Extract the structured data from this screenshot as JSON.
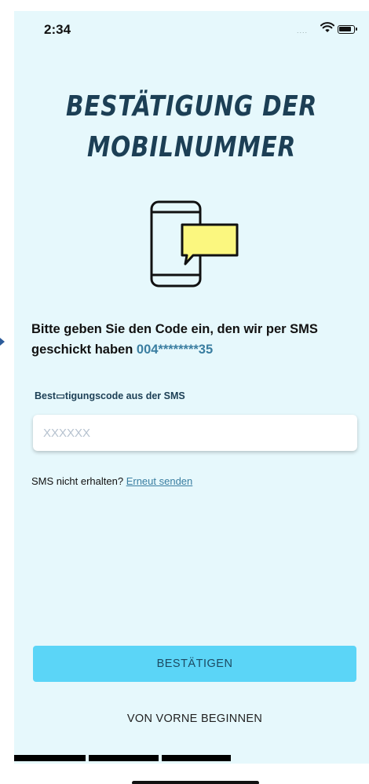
{
  "status_bar": {
    "time": "2:34",
    "signal": "....",
    "wifi_icon": "wifi-icon",
    "battery_icon": "battery-icon"
  },
  "header": {
    "title_line1": "BESTÄTIGUNG DER",
    "title_line2": "MOBILNUMMER"
  },
  "illustration": {
    "icon": "phone-sms-icon",
    "bubble_color": "#fbf77f"
  },
  "instruction": {
    "text": "Bitte geben Sie den Code ein, den wir per SMS geschickt haben",
    "masked_number": "004********35"
  },
  "code_field": {
    "label": "Best▭tigungscode aus der SMS",
    "placeholder": "XXXXXX",
    "value": ""
  },
  "resend": {
    "prompt": "SMS nicht erhalten?",
    "link": "Erneut senden"
  },
  "buttons": {
    "confirm": "BESTÄTIGEN",
    "restart": "VON VORNE BEGINNEN"
  },
  "progress": {
    "completed_steps": 3,
    "total_steps": 4
  },
  "colors": {
    "background": "#e6f8fc",
    "title": "#1c3f55",
    "accent": "#3a7ea1",
    "button": "#5bd5f7"
  }
}
